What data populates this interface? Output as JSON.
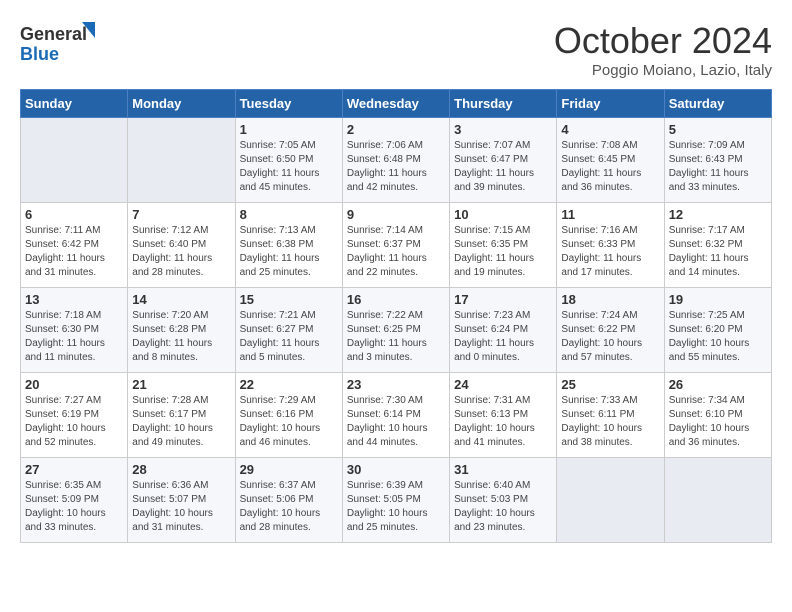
{
  "logo": {
    "line1": "General",
    "line2": "Blue"
  },
  "title": "October 2024",
  "subtitle": "Poggio Moiano, Lazio, Italy",
  "days_of_week": [
    "Sunday",
    "Monday",
    "Tuesday",
    "Wednesday",
    "Thursday",
    "Friday",
    "Saturday"
  ],
  "weeks": [
    [
      {
        "day": "",
        "sunrise": "",
        "sunset": "",
        "daylight": ""
      },
      {
        "day": "",
        "sunrise": "",
        "sunset": "",
        "daylight": ""
      },
      {
        "day": "1",
        "sunrise": "Sunrise: 7:05 AM",
        "sunset": "Sunset: 6:50 PM",
        "daylight": "Daylight: 11 hours and 45 minutes."
      },
      {
        "day": "2",
        "sunrise": "Sunrise: 7:06 AM",
        "sunset": "Sunset: 6:48 PM",
        "daylight": "Daylight: 11 hours and 42 minutes."
      },
      {
        "day": "3",
        "sunrise": "Sunrise: 7:07 AM",
        "sunset": "Sunset: 6:47 PM",
        "daylight": "Daylight: 11 hours and 39 minutes."
      },
      {
        "day": "4",
        "sunrise": "Sunrise: 7:08 AM",
        "sunset": "Sunset: 6:45 PM",
        "daylight": "Daylight: 11 hours and 36 minutes."
      },
      {
        "day": "5",
        "sunrise": "Sunrise: 7:09 AM",
        "sunset": "Sunset: 6:43 PM",
        "daylight": "Daylight: 11 hours and 33 minutes."
      }
    ],
    [
      {
        "day": "6",
        "sunrise": "Sunrise: 7:11 AM",
        "sunset": "Sunset: 6:42 PM",
        "daylight": "Daylight: 11 hours and 31 minutes."
      },
      {
        "day": "7",
        "sunrise": "Sunrise: 7:12 AM",
        "sunset": "Sunset: 6:40 PM",
        "daylight": "Daylight: 11 hours and 28 minutes."
      },
      {
        "day": "8",
        "sunrise": "Sunrise: 7:13 AM",
        "sunset": "Sunset: 6:38 PM",
        "daylight": "Daylight: 11 hours and 25 minutes."
      },
      {
        "day": "9",
        "sunrise": "Sunrise: 7:14 AM",
        "sunset": "Sunset: 6:37 PM",
        "daylight": "Daylight: 11 hours and 22 minutes."
      },
      {
        "day": "10",
        "sunrise": "Sunrise: 7:15 AM",
        "sunset": "Sunset: 6:35 PM",
        "daylight": "Daylight: 11 hours and 19 minutes."
      },
      {
        "day": "11",
        "sunrise": "Sunrise: 7:16 AM",
        "sunset": "Sunset: 6:33 PM",
        "daylight": "Daylight: 11 hours and 17 minutes."
      },
      {
        "day": "12",
        "sunrise": "Sunrise: 7:17 AM",
        "sunset": "Sunset: 6:32 PM",
        "daylight": "Daylight: 11 hours and 14 minutes."
      }
    ],
    [
      {
        "day": "13",
        "sunrise": "Sunrise: 7:18 AM",
        "sunset": "Sunset: 6:30 PM",
        "daylight": "Daylight: 11 hours and 11 minutes."
      },
      {
        "day": "14",
        "sunrise": "Sunrise: 7:20 AM",
        "sunset": "Sunset: 6:28 PM",
        "daylight": "Daylight: 11 hours and 8 minutes."
      },
      {
        "day": "15",
        "sunrise": "Sunrise: 7:21 AM",
        "sunset": "Sunset: 6:27 PM",
        "daylight": "Daylight: 11 hours and 5 minutes."
      },
      {
        "day": "16",
        "sunrise": "Sunrise: 7:22 AM",
        "sunset": "Sunset: 6:25 PM",
        "daylight": "Daylight: 11 hours and 3 minutes."
      },
      {
        "day": "17",
        "sunrise": "Sunrise: 7:23 AM",
        "sunset": "Sunset: 6:24 PM",
        "daylight": "Daylight: 11 hours and 0 minutes."
      },
      {
        "day": "18",
        "sunrise": "Sunrise: 7:24 AM",
        "sunset": "Sunset: 6:22 PM",
        "daylight": "Daylight: 10 hours and 57 minutes."
      },
      {
        "day": "19",
        "sunrise": "Sunrise: 7:25 AM",
        "sunset": "Sunset: 6:20 PM",
        "daylight": "Daylight: 10 hours and 55 minutes."
      }
    ],
    [
      {
        "day": "20",
        "sunrise": "Sunrise: 7:27 AM",
        "sunset": "Sunset: 6:19 PM",
        "daylight": "Daylight: 10 hours and 52 minutes."
      },
      {
        "day": "21",
        "sunrise": "Sunrise: 7:28 AM",
        "sunset": "Sunset: 6:17 PM",
        "daylight": "Daylight: 10 hours and 49 minutes."
      },
      {
        "day": "22",
        "sunrise": "Sunrise: 7:29 AM",
        "sunset": "Sunset: 6:16 PM",
        "daylight": "Daylight: 10 hours and 46 minutes."
      },
      {
        "day": "23",
        "sunrise": "Sunrise: 7:30 AM",
        "sunset": "Sunset: 6:14 PM",
        "daylight": "Daylight: 10 hours and 44 minutes."
      },
      {
        "day": "24",
        "sunrise": "Sunrise: 7:31 AM",
        "sunset": "Sunset: 6:13 PM",
        "daylight": "Daylight: 10 hours and 41 minutes."
      },
      {
        "day": "25",
        "sunrise": "Sunrise: 7:33 AM",
        "sunset": "Sunset: 6:11 PM",
        "daylight": "Daylight: 10 hours and 38 minutes."
      },
      {
        "day": "26",
        "sunrise": "Sunrise: 7:34 AM",
        "sunset": "Sunset: 6:10 PM",
        "daylight": "Daylight: 10 hours and 36 minutes."
      }
    ],
    [
      {
        "day": "27",
        "sunrise": "Sunrise: 6:35 AM",
        "sunset": "Sunset: 5:09 PM",
        "daylight": "Daylight: 10 hours and 33 minutes."
      },
      {
        "day": "28",
        "sunrise": "Sunrise: 6:36 AM",
        "sunset": "Sunset: 5:07 PM",
        "daylight": "Daylight: 10 hours and 31 minutes."
      },
      {
        "day": "29",
        "sunrise": "Sunrise: 6:37 AM",
        "sunset": "Sunset: 5:06 PM",
        "daylight": "Daylight: 10 hours and 28 minutes."
      },
      {
        "day": "30",
        "sunrise": "Sunrise: 6:39 AM",
        "sunset": "Sunset: 5:05 PM",
        "daylight": "Daylight: 10 hours and 25 minutes."
      },
      {
        "day": "31",
        "sunrise": "Sunrise: 6:40 AM",
        "sunset": "Sunset: 5:03 PM",
        "daylight": "Daylight: 10 hours and 23 minutes."
      },
      {
        "day": "",
        "sunrise": "",
        "sunset": "",
        "daylight": ""
      },
      {
        "day": "",
        "sunrise": "",
        "sunset": "",
        "daylight": ""
      }
    ]
  ]
}
